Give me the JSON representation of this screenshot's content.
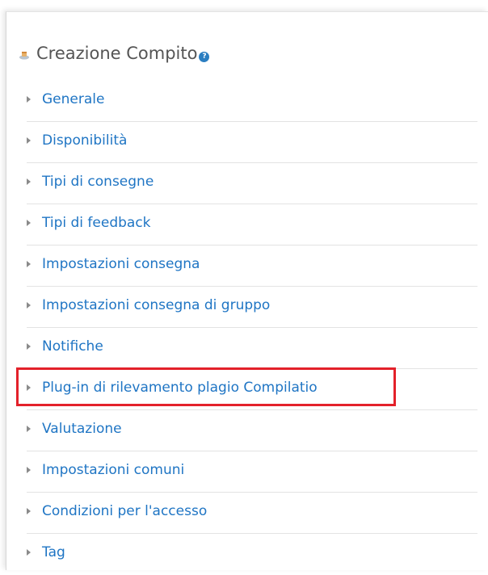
{
  "panel": {
    "title": "Creazione Compito",
    "help_icon": "question-circle-icon",
    "title_icon": "assignment-icon"
  },
  "sections": [
    {
      "label": "Generale"
    },
    {
      "label": "Disponibilità"
    },
    {
      "label": "Tipi di consegne"
    },
    {
      "label": "Tipi di feedback"
    },
    {
      "label": "Impostazioni consegna"
    },
    {
      "label": "Impostazioni consegna di gruppo"
    },
    {
      "label": "Notifiche"
    },
    {
      "label": "Plug-in di rilevamento plagio Compilatio"
    },
    {
      "label": "Valutazione"
    },
    {
      "label": "Impostazioni comuni"
    },
    {
      "label": "Condizioni per l'accesso"
    },
    {
      "label": "Tag"
    }
  ],
  "colors": {
    "link": "#1f75c4",
    "title": "#555555",
    "highlight": "#e3212a",
    "help_icon": "#2b7ec1"
  }
}
